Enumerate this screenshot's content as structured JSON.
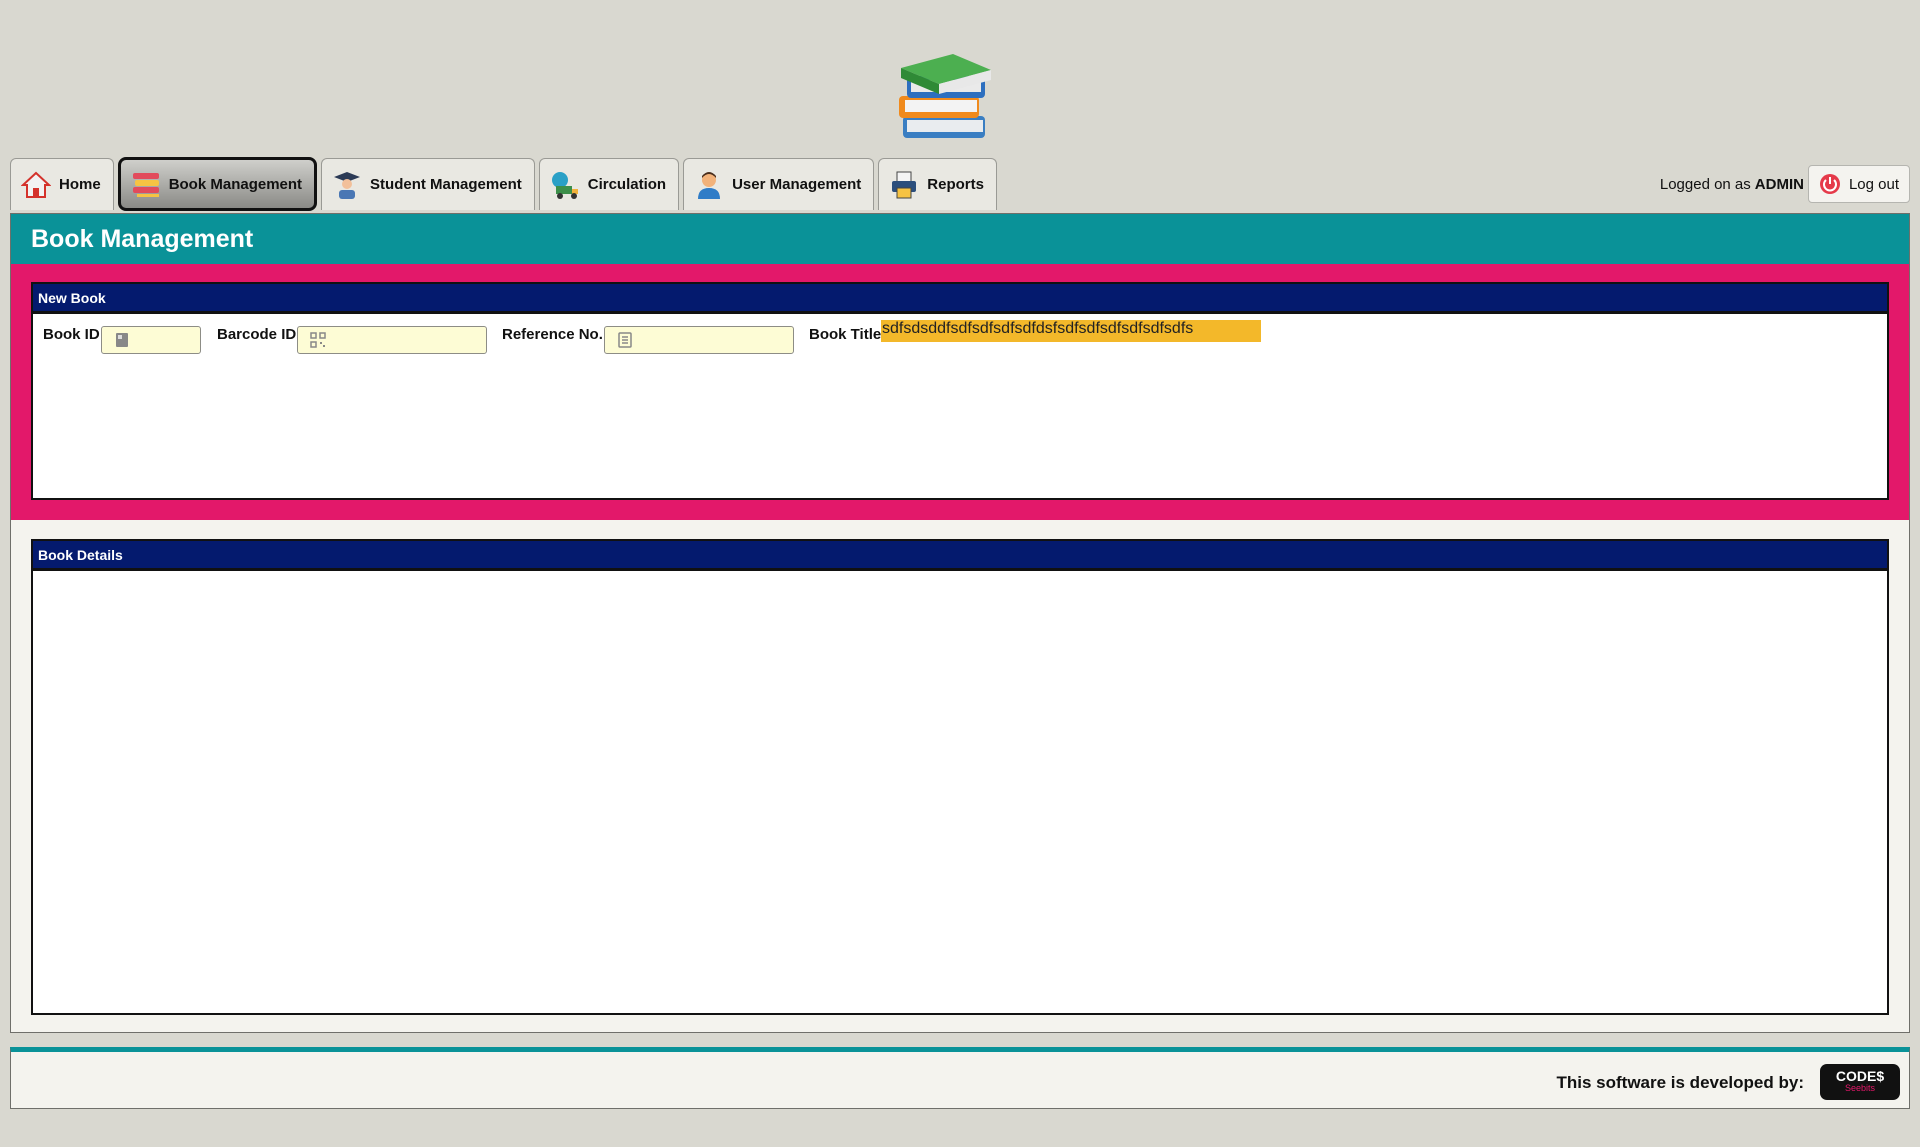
{
  "app": {
    "logo_icon": "books-stack-icon"
  },
  "nav": {
    "tabs": [
      {
        "label": "Home",
        "icon": "home-icon"
      },
      {
        "label": "Book Management",
        "icon": "books-icon",
        "active": true
      },
      {
        "label": "Student Management",
        "icon": "graduate-icon"
      },
      {
        "label": "Circulation",
        "icon": "delivery-truck-icon"
      },
      {
        "label": "User Management",
        "icon": "user-icon"
      },
      {
        "label": "Reports",
        "icon": "printer-icon"
      }
    ]
  },
  "session": {
    "logged_label": "Logged on as",
    "username": "ADMIN",
    "logout_label": "Log out"
  },
  "page": {
    "title": "Book Management",
    "new_book": {
      "title": "New Book",
      "book_id_label": "Book ID",
      "book_id_value": "",
      "barcode_label": "Barcode ID",
      "barcode_value": "",
      "reference_label": "Reference No.",
      "reference_value": "",
      "book_title_label": "Book Title",
      "book_title_value": "sdfsdsddfsdfsdfsdfsdfdsfsdfsdfsdfsdfsdfsdfs"
    },
    "book_details": {
      "title": "Book Details"
    }
  },
  "footer": {
    "developed_by": "This software is developed by:",
    "brand_top": "CODE$",
    "brand_bottom": "Seebits"
  },
  "colors": {
    "background": "#d9d8d0",
    "header_teal": "#0a9298",
    "band_pink": "#e3186a",
    "panel_navy": "#041a6e",
    "input_yellow": "#fdfcd5",
    "selection": "#f3b82a"
  }
}
